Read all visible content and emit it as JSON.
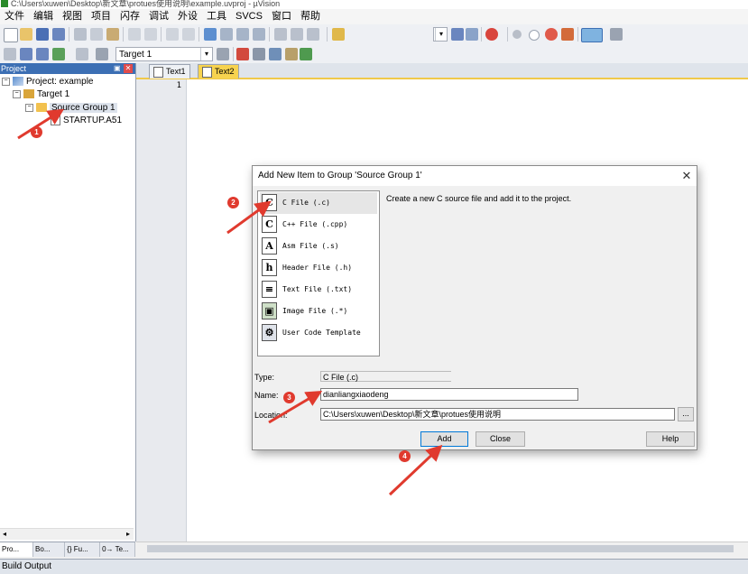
{
  "window": {
    "title": "C:\\Users\\xuwen\\Desktop\\新文章\\protues使用说明\\example.uvproj - µVision"
  },
  "menu": [
    "文件",
    "编辑",
    "视图",
    "项目",
    "闪存",
    "调试",
    "外设",
    "工具",
    "SVCS",
    "窗口",
    "帮助"
  ],
  "toolbar": {
    "target_combo": "Target 1"
  },
  "project_panel": {
    "title": "Project",
    "tree": [
      {
        "label": "Project: example",
        "level": 0,
        "expander": "−",
        "icon": "project-icon"
      },
      {
        "label": "Target 1",
        "level": 1,
        "expander": "−",
        "icon": "target-icon"
      },
      {
        "label": "Source Group 1",
        "level": 2,
        "expander": "−",
        "icon": "folder-icon"
      },
      {
        "label": "STARTUP.A51",
        "level": 3,
        "expander": "",
        "icon": "asm-file-icon"
      }
    ],
    "tabs": [
      "Pro...",
      "Bo...",
      "{} Fu...",
      "0→ Te..."
    ]
  },
  "editor": {
    "tabs": [
      "Text1",
      "Text2"
    ],
    "active_tab": "Text2",
    "line_number": "1"
  },
  "build_output": {
    "title": "Build Output"
  },
  "dialog": {
    "title": "Add New Item to Group 'Source Group 1'",
    "close_glyph": "✕",
    "description": "Create a new C source file and add it to the project.",
    "items": [
      {
        "label": "C File (.c)",
        "icon": "C",
        "selected": true
      },
      {
        "label": "C++ File (.cpp)",
        "icon": "C",
        "selected": false
      },
      {
        "label": "Asm File (.s)",
        "icon": "A",
        "selected": false
      },
      {
        "label": "Header File (.h)",
        "icon": "h",
        "selected": false
      },
      {
        "label": "Text File (.txt)",
        "icon": "≡",
        "selected": false
      },
      {
        "label": "Image File (.*)",
        "icon": "▣",
        "selected": false
      },
      {
        "label": "User Code Template",
        "icon": "⚙",
        "selected": false
      }
    ],
    "type_label": "Type:",
    "type_value": "C File (.c)",
    "name_label": "Name:",
    "name_value": "dianliangxiaodeng",
    "location_label": "Location:",
    "location_value": "C:\\Users\\xuwen\\Desktop\\新文章\\protues使用说明",
    "browse_label": "...",
    "add_label": "Add",
    "close_label": "Close",
    "help_label": "Help"
  },
  "annotations": [
    "1",
    "2",
    "3",
    "4"
  ],
  "colors": {
    "accent": "#3c6fb4",
    "annotation_red": "#e03a2e",
    "active_tab": "#f7d34f"
  }
}
